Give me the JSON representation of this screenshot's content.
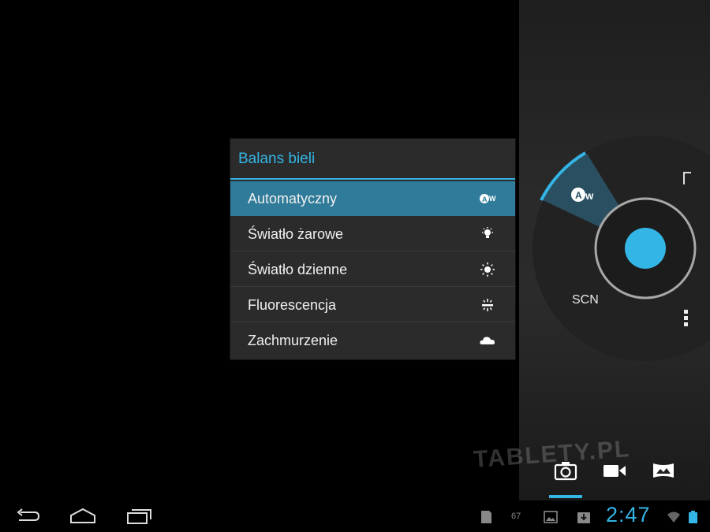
{
  "popup": {
    "title": "Balans bieli",
    "items": [
      {
        "label": "Automatyczny",
        "icon": "auto-wb-icon",
        "selected": true
      },
      {
        "label": "Światło żarowe",
        "icon": "incandescent-icon",
        "selected": false
      },
      {
        "label": "Światło dzienne",
        "icon": "daylight-icon",
        "selected": false
      },
      {
        "label": "Fluorescencja",
        "icon": "fluorescent-icon",
        "selected": false
      },
      {
        "label": "Zachmurzenie",
        "icon": "cloudy-icon",
        "selected": false
      }
    ]
  },
  "wheel": {
    "scene_label": "SCN",
    "active_badge": "AW"
  },
  "status_bar": {
    "notification_count": "67",
    "time": "2:47"
  },
  "watermark": "TABLETY.PL",
  "colors": {
    "accent": "#33b5e5",
    "selected_row": "#2f7b99",
    "panel": "#2b2b2b"
  }
}
